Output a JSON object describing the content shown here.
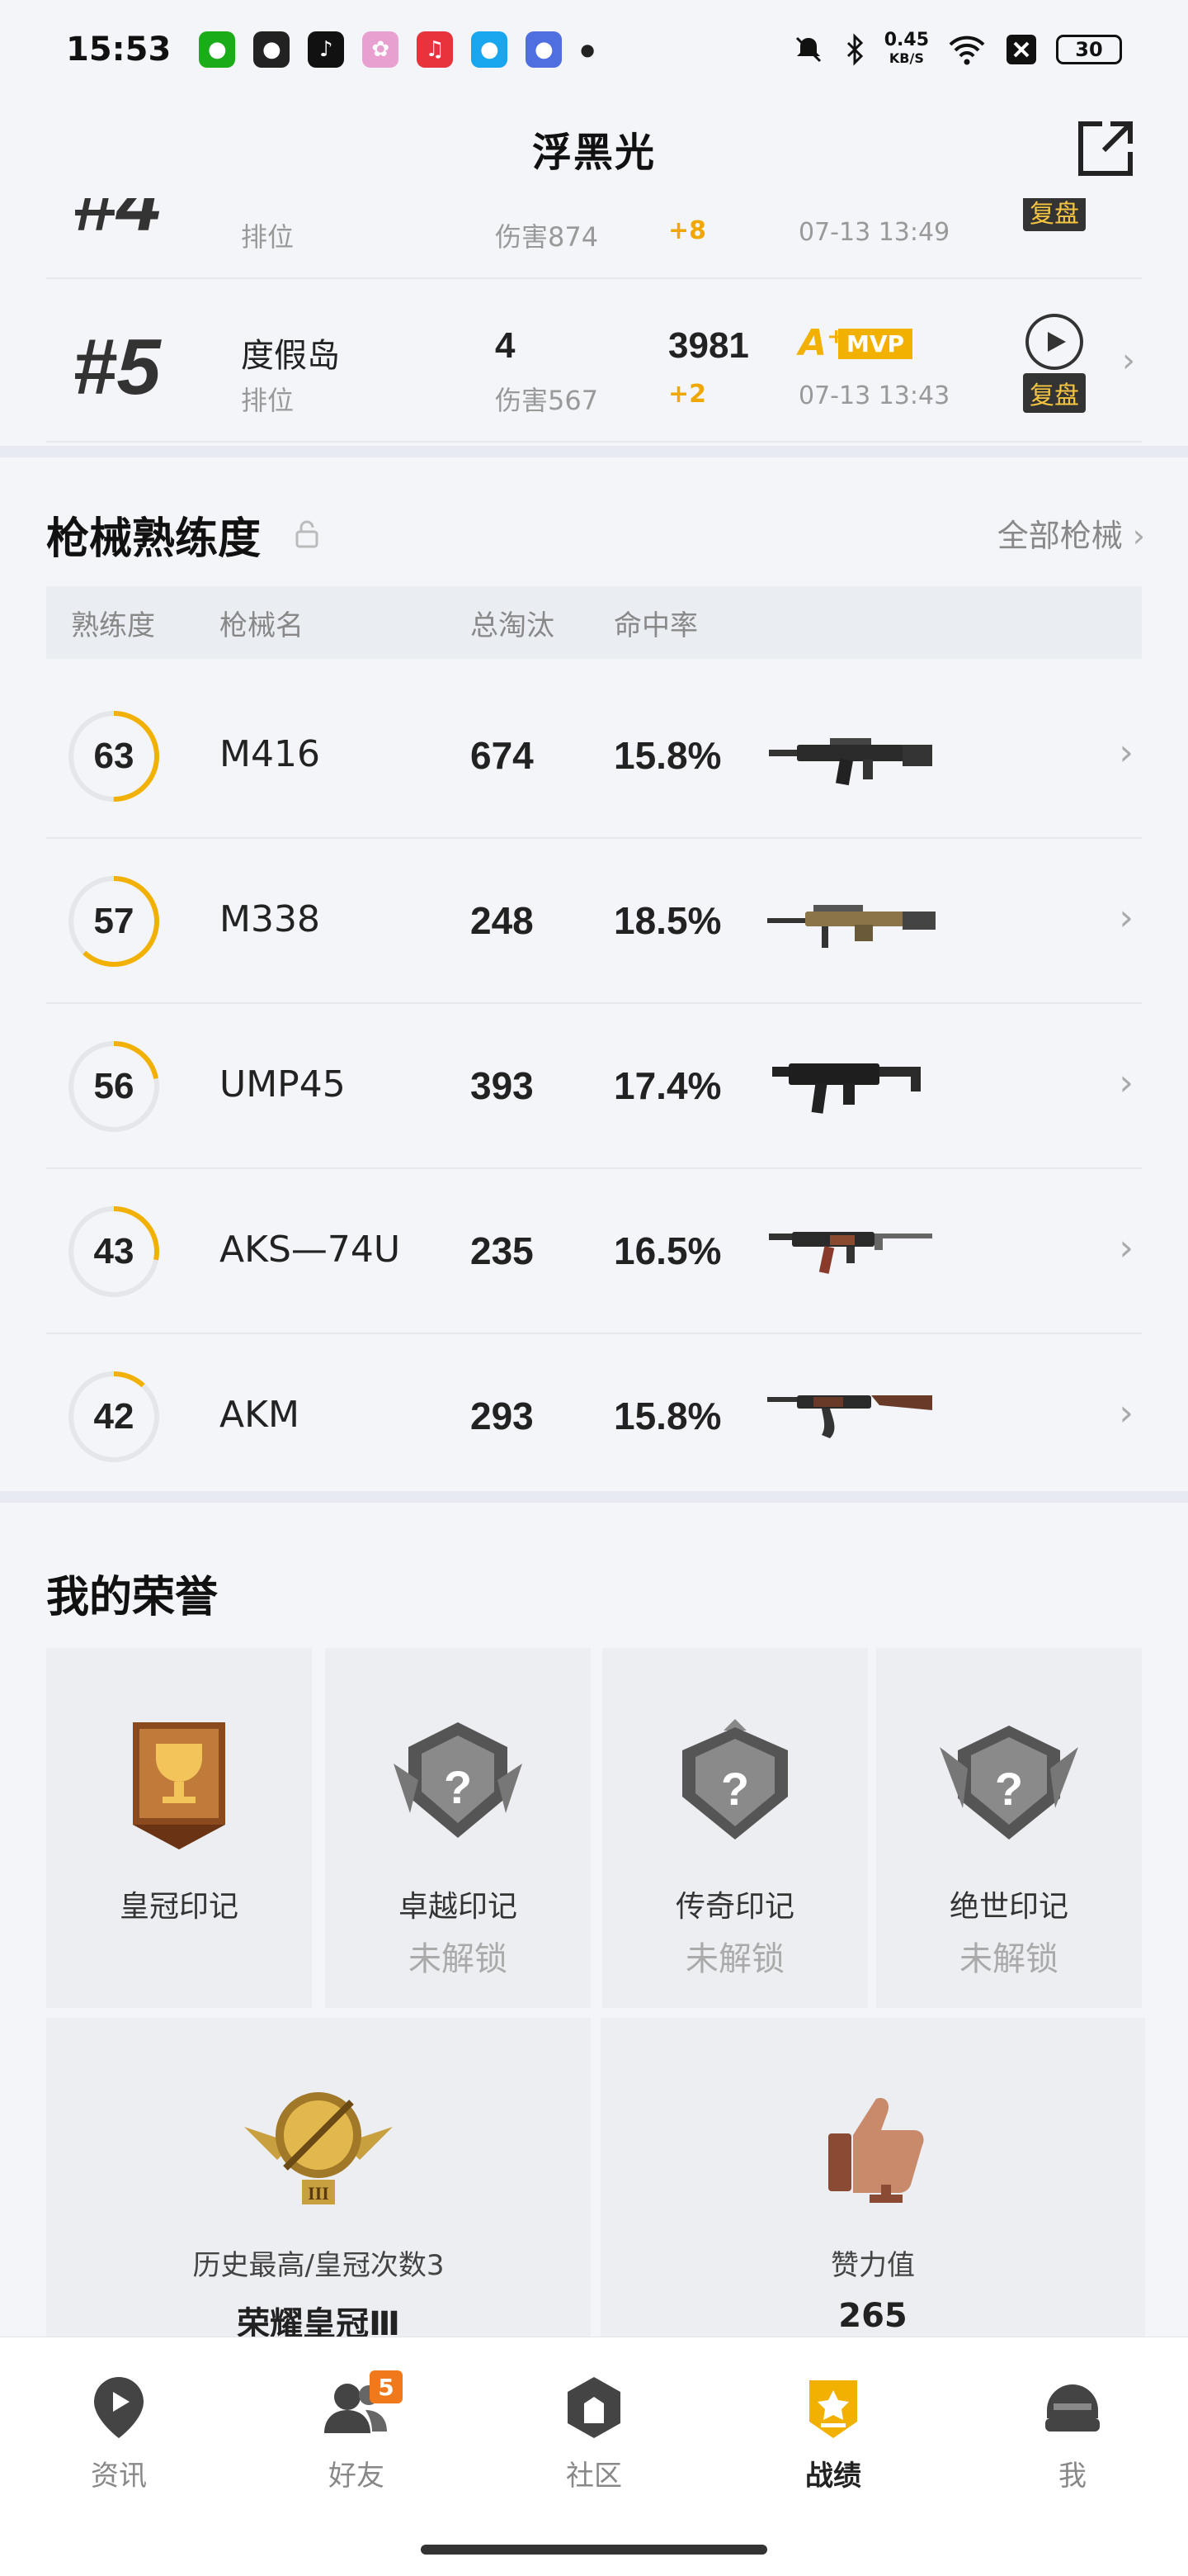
{
  "status_bar": {
    "time": "15:53",
    "network_speed_value": "0.45",
    "network_speed_unit": "KB/S",
    "battery": "30",
    "icons": [
      "wechat-icon",
      "bear-icon",
      "tiktok-icon",
      "flower-icon",
      "music-icon",
      "qq-icon",
      "game-icon",
      "dot-icon",
      "mute-icon",
      "bluetooth-icon",
      "wifi-icon",
      "close-box-icon",
      "battery-icon"
    ]
  },
  "header": {
    "title": "浮黑光"
  },
  "matches": [
    {
      "rank": "#4",
      "map": "",
      "mode": "排位",
      "kills": "",
      "damage": "伤害874",
      "score": "",
      "delta": "+8",
      "grade": "",
      "mvp": "",
      "time": "07-13 13:49",
      "replay": "复盘"
    },
    {
      "rank": "#5",
      "map": "度假岛",
      "mode": "排位",
      "kills": "4",
      "damage": "伤害567",
      "score": "3981",
      "delta": "+2",
      "grade": "A⁺",
      "mvp": "MVP",
      "time": "07-13 13:43",
      "replay": "复盘"
    }
  ],
  "weapons": {
    "title": "枪械熟练度",
    "all_link": "全部枪械",
    "headers": {
      "mastery": "熟练度",
      "name": "枪械名",
      "kills": "总淘汰",
      "accuracy": "命中率"
    },
    "rows": [
      {
        "mastery": "63",
        "mastery_fraction": 0.5,
        "name": "M416",
        "kills": "674",
        "accuracy": "15.8%"
      },
      {
        "mastery": "57",
        "mastery_fraction": 0.62,
        "name": "M338",
        "kills": "248",
        "accuracy": "18.5%"
      },
      {
        "mastery": "56",
        "mastery_fraction": 0.22,
        "name": "UMP45",
        "kills": "393",
        "accuracy": "17.4%"
      },
      {
        "mastery": "43",
        "mastery_fraction": 0.28,
        "name": "AKS—74U",
        "kills": "235",
        "accuracy": "16.5%"
      },
      {
        "mastery": "42",
        "mastery_fraction": 0.12,
        "name": "AKM",
        "kills": "293",
        "accuracy": "15.8%"
      }
    ]
  },
  "honors": {
    "title": "我的荣誉",
    "badges": [
      {
        "name": "皇冠印记",
        "status": ""
      },
      {
        "name": "卓越印记",
        "status": "未解锁"
      },
      {
        "name": "传奇印记",
        "status": "未解锁"
      },
      {
        "name": "绝世印记",
        "status": "未解锁"
      }
    ],
    "highest": {
      "label": "历史最高/皇冠次数3",
      "value": "荣耀皇冠Ⅲ"
    },
    "likes": {
      "label": "赞力值",
      "value": "265"
    }
  },
  "nav": [
    {
      "label": "资讯",
      "icon": "news-icon"
    },
    {
      "label": "好友",
      "icon": "friends-icon",
      "badge": "5"
    },
    {
      "label": "社区",
      "icon": "community-icon"
    },
    {
      "label": "战绩",
      "icon": "record-icon",
      "active": true
    },
    {
      "label": "我",
      "icon": "profile-icon"
    }
  ],
  "colors": {
    "accent": "#f2b100",
    "ring_track": "#e4e6ea",
    "badge_orange": "#f07a1b"
  }
}
